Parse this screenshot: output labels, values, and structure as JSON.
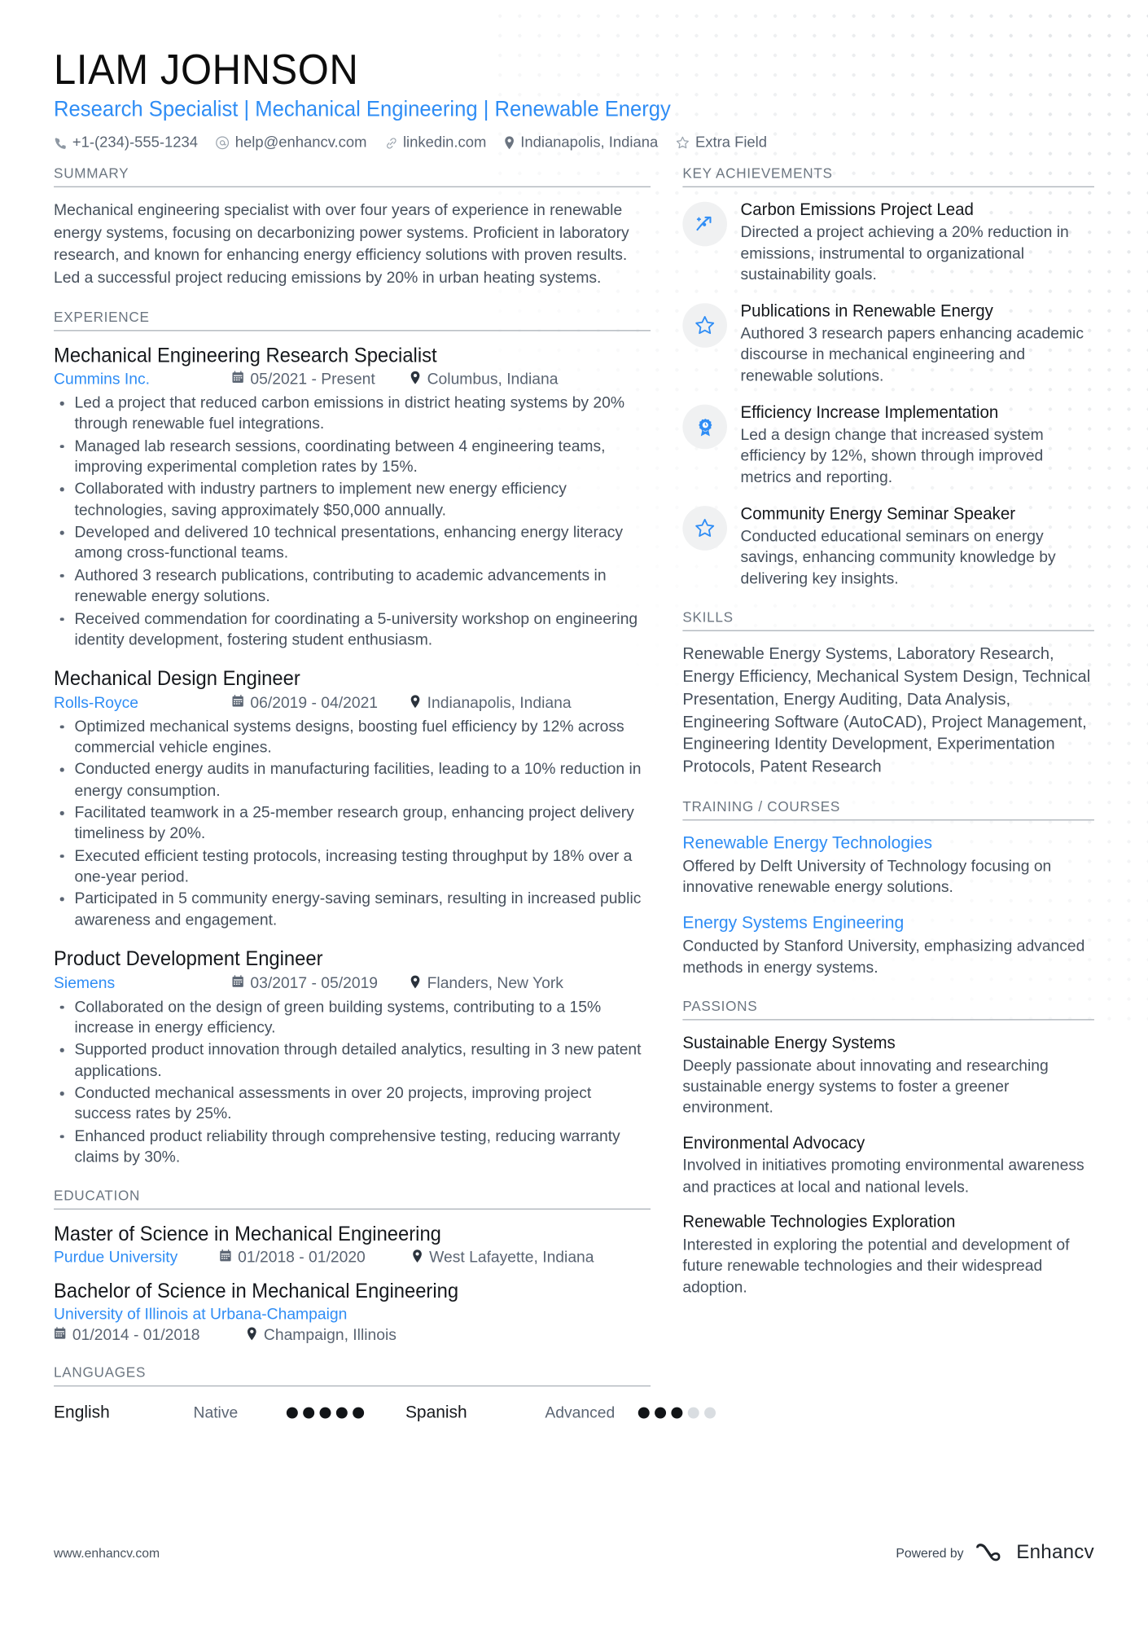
{
  "header": {
    "name": "LIAM JOHNSON",
    "headline": "Research Specialist | Mechanical Engineering | Renewable Energy",
    "contacts": [
      {
        "icon": "phone-icon",
        "text": "+1-(234)-555-1234"
      },
      {
        "icon": "email-icon",
        "text": "help@enhancv.com"
      },
      {
        "icon": "link-icon",
        "text": "linkedin.com"
      },
      {
        "icon": "location-icon",
        "text": "Indianapolis, Indiana"
      },
      {
        "icon": "star-icon",
        "text": "Extra Field"
      }
    ]
  },
  "summary": {
    "title": "SUMMARY",
    "text": "Mechanical engineering specialist with over four years of experience in renewable energy systems, focusing on decarbonizing power systems. Proficient in laboratory research, and known for enhancing energy efficiency solutions with proven results. Led a successful project reducing emissions by 20% in urban heating systems."
  },
  "experience": {
    "title": "EXPERIENCE",
    "jobs": [
      {
        "title": "Mechanical Engineering Research Specialist",
        "company": "Cummins Inc.",
        "dates": "05/2021 - Present",
        "location": "Columbus, Indiana",
        "bullets": [
          "Led a project that reduced carbon emissions in district heating systems by 20% through renewable fuel integrations.",
          "Managed lab research sessions, coordinating between 4 engineering teams, improving experimental completion rates by 15%.",
          "Collaborated with industry partners to implement new energy efficiency technologies, saving approximately $50,000 annually.",
          "Developed and delivered 10 technical presentations, enhancing energy literacy among cross-functional teams.",
          "Authored 3 research publications, contributing to academic advancements in renewable energy solutions.",
          "Received commendation for coordinating a 5-university workshop on engineering identity development, fostering student enthusiasm."
        ]
      },
      {
        "title": "Mechanical Design Engineer",
        "company": "Rolls-Royce",
        "dates": "06/2019 - 04/2021",
        "location": "Indianapolis, Indiana",
        "bullets": [
          "Optimized mechanical systems designs, boosting fuel efficiency by 12% across commercial vehicle engines.",
          "Conducted energy audits in manufacturing facilities, leading to a 10% reduction in energy consumption.",
          "Facilitated teamwork in a 25-member research group, enhancing project delivery timeliness by 20%.",
          "Executed efficient testing protocols, increasing testing throughput by 18% over a one-year period.",
          "Participated in 5 community energy-saving seminars, resulting in increased public awareness and engagement."
        ]
      },
      {
        "title": "Product Development Engineer",
        "company": "Siemens",
        "dates": "03/2017 - 05/2019",
        "location": "Flanders, New York",
        "bullets": [
          "Collaborated on the design of green building systems, contributing to a 15% increase in energy efficiency.",
          "Supported product innovation through detailed analytics, resulting in 3 new patent applications.",
          "Conducted mechanical assessments in over 20 projects, improving project success rates by 25%.",
          "Enhanced product reliability through comprehensive testing, reducing warranty claims by 30%."
        ]
      }
    ]
  },
  "education": {
    "title": "EDUCATION",
    "items": [
      {
        "degree": "Master of Science in Mechanical Engineering",
        "school": "Purdue University",
        "dates": "01/2018 - 01/2020",
        "location": "West Lafayette, Indiana",
        "wrap": false
      },
      {
        "degree": "Bachelor of Science in Mechanical Engineering",
        "school": "University of Illinois at Urbana-Champaign",
        "dates": "01/2014 - 01/2018",
        "location": "Champaign, Illinois",
        "wrap": true
      }
    ]
  },
  "languages": {
    "title": "LANGUAGES",
    "items": [
      {
        "name": "English",
        "level": "Native",
        "filled": 5,
        "total": 5
      },
      {
        "name": "Spanish",
        "level": "Advanced",
        "filled": 3,
        "total": 5
      }
    ]
  },
  "key_achievements": {
    "title": "KEY ACHIEVEMENTS",
    "items": [
      {
        "icon": "trending-up-icon",
        "title": "Carbon Emissions Project Lead",
        "desc": "Directed a project achieving a 20% reduction in emissions, instrumental to organizational sustainability goals."
      },
      {
        "icon": "star-icon",
        "title": "Publications in Renewable Energy",
        "desc": "Authored 3 research papers enhancing academic discourse in mechanical engineering and renewable solutions."
      },
      {
        "icon": "award-icon",
        "title": "Efficiency Increase Implementation",
        "desc": "Led a design change that increased system efficiency by 12%, shown through improved metrics and reporting."
      },
      {
        "icon": "star-icon",
        "title": "Community Energy Seminar Speaker",
        "desc": "Conducted educational seminars on energy savings, enhancing community knowledge by delivering key insights."
      }
    ]
  },
  "skills": {
    "title": "SKILLS",
    "text": "Renewable Energy Systems, Laboratory Research, Energy Efficiency, Mechanical System Design, Technical Presentation, Energy Auditing, Data Analysis, Engineering Software (AutoCAD), Project Management, Engineering Identity Development, Experimentation Protocols, Patent Research"
  },
  "training": {
    "title": "TRAINING / COURSES",
    "items": [
      {
        "title": "Renewable Energy Technologies",
        "desc": "Offered by Delft University of Technology focusing on innovative renewable energy solutions."
      },
      {
        "title": "Energy Systems Engineering",
        "desc": "Conducted by Stanford University, emphasizing advanced methods in energy systems."
      }
    ]
  },
  "passions": {
    "title": "PASSIONS",
    "items": [
      {
        "title": "Sustainable Energy Systems",
        "desc": "Deeply passionate about innovating and researching sustainable energy systems to foster a greener environment."
      },
      {
        "title": "Environmental Advocacy",
        "desc": "Involved in initiatives promoting environmental awareness and practices at local and national levels."
      },
      {
        "title": "Renewable Technologies Exploration",
        "desc": "Interested in exploring the potential and development of future renewable technologies and their widespread adoption."
      }
    ]
  },
  "footer": {
    "website": "www.enhancv.com",
    "powered_label": "Powered by",
    "brand": "Enhancv"
  },
  "colors": {
    "accent": "#2f8df5",
    "heading": "#6c7681",
    "body": "#46505c"
  }
}
